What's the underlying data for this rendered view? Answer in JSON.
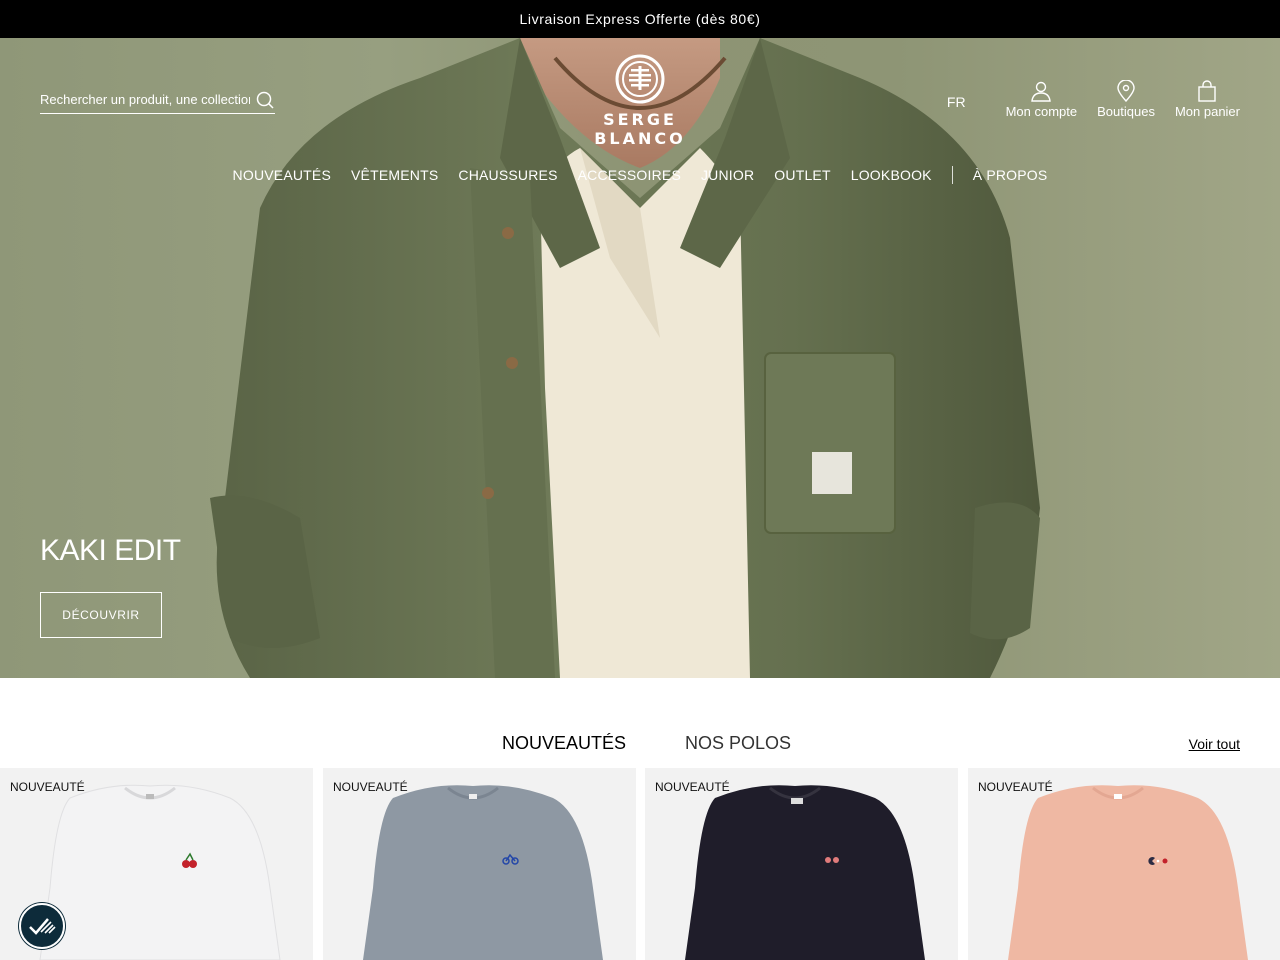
{
  "promo": {
    "text": "Livraison Express Offerte (dès 80€)"
  },
  "header": {
    "search_placeholder": "Rechercher un produit, une collection...",
    "logo_text": "SERGE BLANCO",
    "language": "FR",
    "account_label": "Mon compte",
    "stores_label": "Boutiques",
    "cart_label": "Mon panier"
  },
  "nav": {
    "items": [
      "NOUVEAUTÉS",
      "VÊTEMENTS",
      "CHAUSSURES",
      "ACCESSOIRES",
      "JUNIOR",
      "OUTLET",
      "LOOKBOOK"
    ],
    "about": "À PROPOS"
  },
  "hero": {
    "title": "KAKI EDIT",
    "cta": "DÉCOUVRIR"
  },
  "section": {
    "tabs": [
      "NOUVEAUTÉS",
      "NOS POLOS"
    ],
    "active_tab": "NOUVEAUTÉS",
    "see_all": "Voir tout"
  },
  "products": [
    {
      "badge": "NOUVEAUTÉ",
      "color": "#f3f3f4",
      "emblem": "cherry-icon"
    },
    {
      "badge": "NOUVEAUTÉ",
      "color": "#8e98a3",
      "emblem": "bicycle-icon"
    },
    {
      "badge": "NOUVEAUTÉ",
      "color": "#1f1d2a",
      "emblem": "dots-icon"
    },
    {
      "badge": "NOUVEAUTÉ",
      "color": "#efb8a3",
      "emblem": "pacman-icon"
    }
  ],
  "colors": {
    "promo_bg": "#000000",
    "hero_bg": "#8f9778",
    "card_bg": "#f2f2f2",
    "a11y_bg": "#0d2b3a"
  }
}
